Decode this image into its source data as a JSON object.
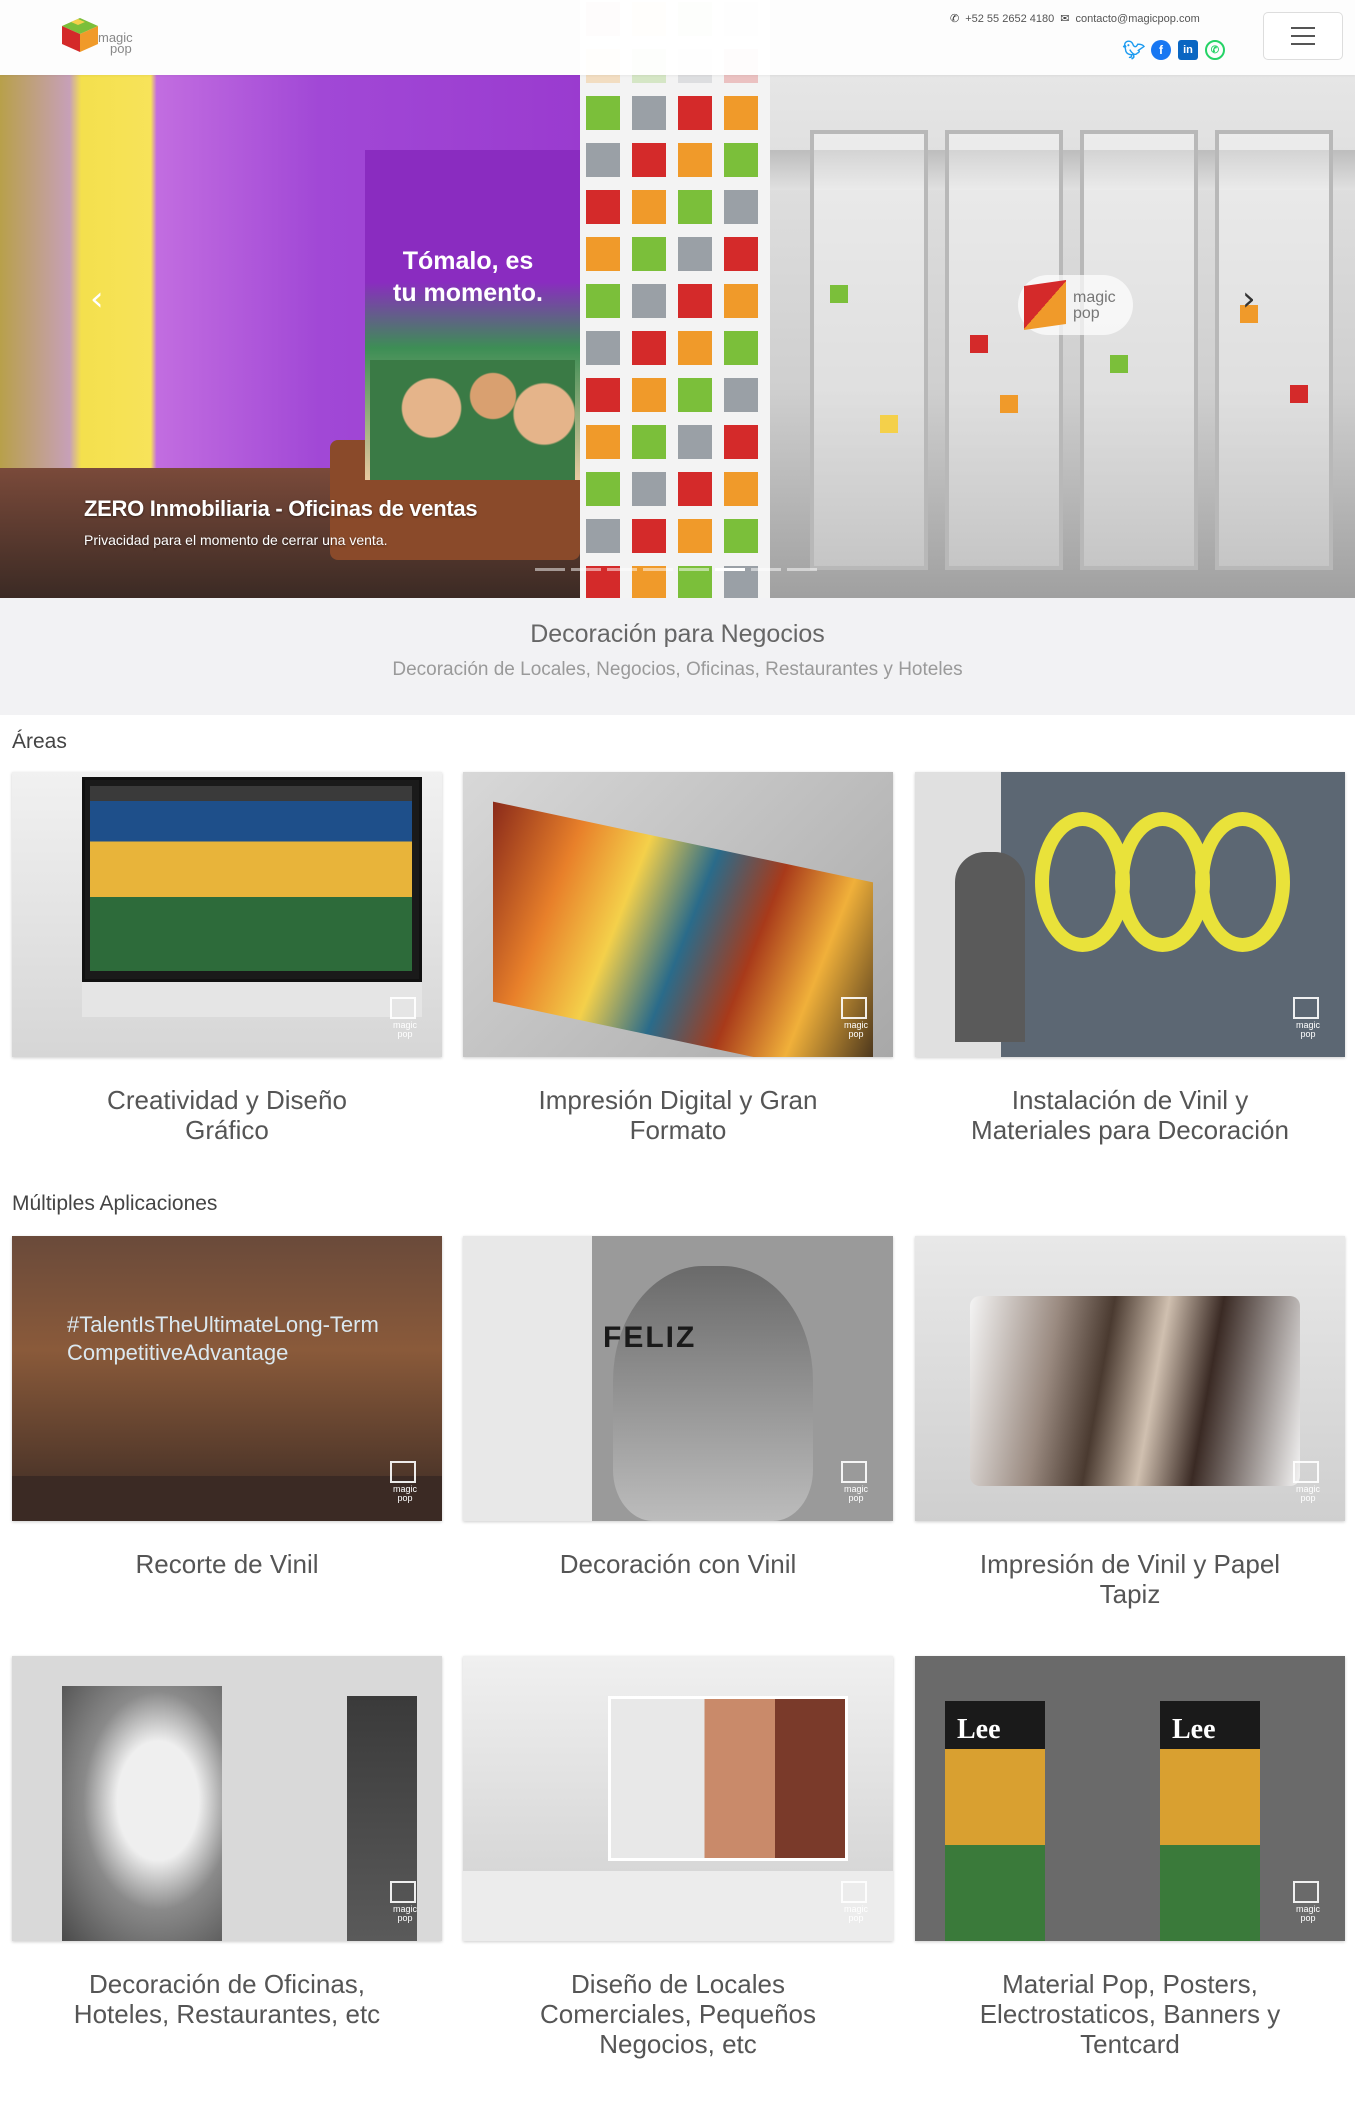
{
  "header": {
    "logo_text_1": "magic",
    "logo_text_2": "pop",
    "phone": "+52 55 2652 4180",
    "email": "contacto@magicpop.com",
    "socials": [
      "twitter",
      "facebook",
      "linkedin",
      "whatsapp"
    ],
    "menu_label": "menu"
  },
  "hero": {
    "poster_line_1": "Tómalo, es",
    "poster_line_2": "tu momento.",
    "caption_title": "ZERO Inmobiliaria - Oficinas de ventas",
    "caption_subtitle": "Privacidad para el momento de cerrar una venta.",
    "logo_text_1": "magic",
    "logo_text_2": "pop",
    "slide_count": 8,
    "active_slide": 6
  },
  "tagline": {
    "title": "Decoración para Negocios",
    "subtitle": "Decoración de Locales, Negocios, Oficinas, Restaurantes y Hoteles"
  },
  "sections": {
    "areas": {
      "title": "Áreas",
      "cards": [
        {
          "title": "Creatividad y Diseño Gráfico"
        },
        {
          "title": "Impresión Digital y Gran Formato"
        },
        {
          "title": "Instalación de Vinil y Materiales para Decoración"
        }
      ]
    },
    "apps": {
      "title": "Múltiples Aplicaciones",
      "cards": [
        {
          "title": "Recorte de Vinil",
          "image_text": "#TalentIsTheUltimateLong-TermCompetitiveAdvantage"
        },
        {
          "title": "Decoración con Vinil",
          "image_text": "FELIZ"
        },
        {
          "title": "Impresión de Vinil y Papel Tapiz"
        },
        {
          "title": "Decoración de Oficinas, Hoteles, Restaurantes, etc"
        },
        {
          "title": "Diseño de Locales Comerciales, Pequeños Negocios, etc"
        },
        {
          "title": "Material Pop, Posters, Electrostaticos, Banners y Tentcard",
          "image_text": "Lee"
        }
      ]
    }
  },
  "watermark": {
    "line1": "magic",
    "line2": "pop"
  },
  "colors": {
    "accent_red": "#d42a2a",
    "accent_orange": "#f09a2a",
    "accent_green": "#7bbf3a",
    "tagline_bg": "#f2f2f4"
  }
}
